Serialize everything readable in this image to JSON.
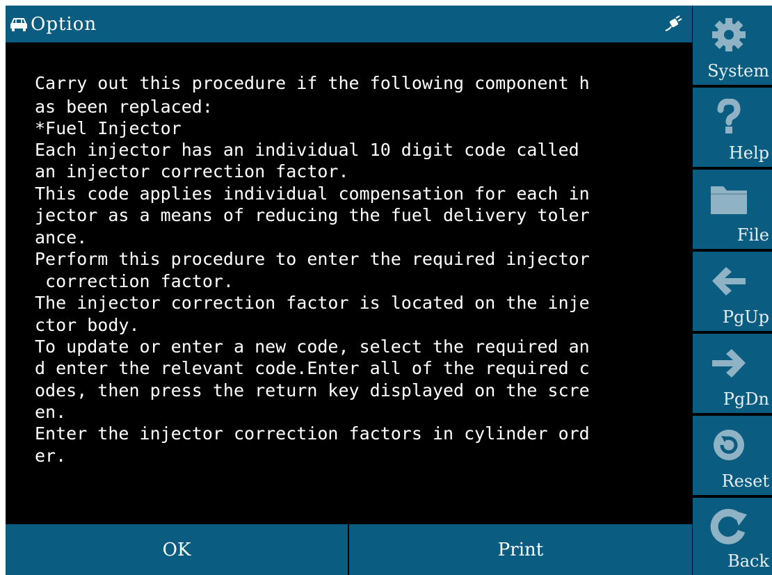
{
  "window": {
    "title": "Option"
  },
  "content": {
    "lines": [
      "Carry out this procedure if the following component h",
      "as been replaced:",
      "*Fuel Injector",
      "Each injector has an individual 10 digit code called",
      "an injector correction factor.",
      "This code applies individual compensation for each in",
      "jector as a means of reducing the fuel delivery toler",
      "ance.",
      "Perform this procedure to enter the required injector",
      " correction factor.",
      "The injector correction factor is located on the inje",
      "ctor body.",
      "To update or enter a new code, select the required an",
      "d enter the relevant code.Enter all of the required c",
      "odes, then press the return key displayed on the scre",
      "en.",
      "Enter the injector correction factors in cylinder ord",
      "er."
    ]
  },
  "bottom_buttons": {
    "ok": "OK",
    "print": "Print"
  },
  "sidebar": {
    "items": [
      {
        "label": "System",
        "icon": "gear-icon"
      },
      {
        "label": "Help",
        "icon": "question-icon"
      },
      {
        "label": "File",
        "icon": "folder-icon"
      },
      {
        "label": "PgUp",
        "icon": "arrow-left-icon"
      },
      {
        "label": "PgDn",
        "icon": "arrow-right-icon"
      },
      {
        "label": "Reset",
        "icon": "reset-icon"
      },
      {
        "label": "Back",
        "icon": "back-icon"
      }
    ]
  },
  "colors": {
    "bar": "#0a5d80",
    "icon": "#8fb3c4",
    "content_bg": "#000000",
    "text": "#ffffff"
  }
}
